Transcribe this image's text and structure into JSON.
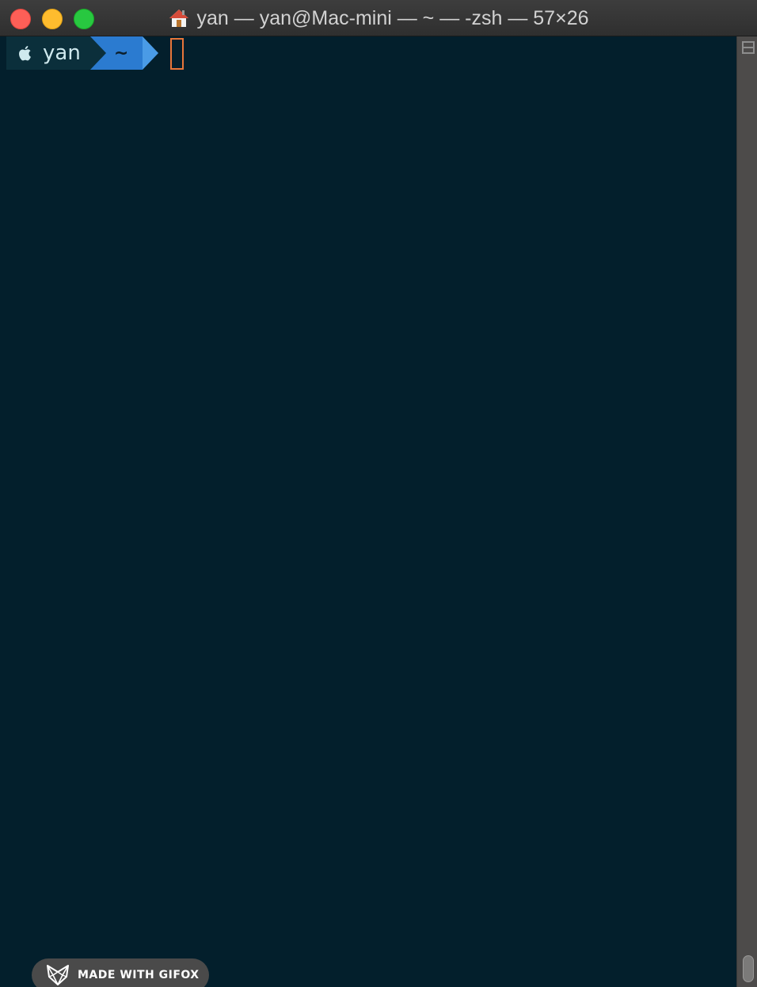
{
  "window": {
    "title": "yan — yan@Mac-mini — ~ — -zsh — 57×26",
    "title_icon": "home-icon"
  },
  "prompt": {
    "os_icon": "apple-icon",
    "user": "yan",
    "directory": "~"
  },
  "badge": {
    "icon": "fox-icon",
    "text": "MADE WITH GIFOX"
  },
  "colors": {
    "terminal_background": "#031f2c",
    "user_segment": "#0b2f3b",
    "directory_segment": "#2b7bd0",
    "cursor": "#e8763a",
    "close": "#fe5f57",
    "minimize": "#febc2e",
    "maximize": "#28c840"
  }
}
